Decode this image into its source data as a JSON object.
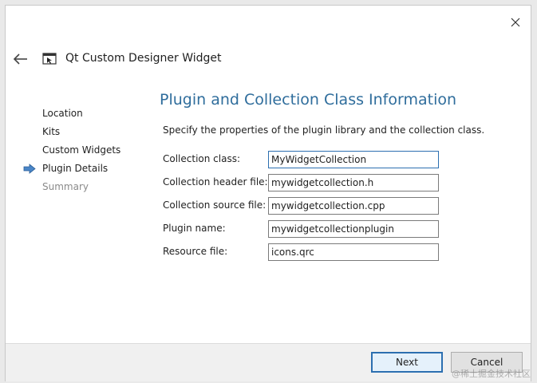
{
  "window": {
    "title": "Qt Custom Designer Widget",
    "app_icon": "qt-designer-widget-icon",
    "back_icon": "back-arrow-icon",
    "close_icon": "close-icon"
  },
  "steps": [
    {
      "label": "Location",
      "state": "done"
    },
    {
      "label": "Kits",
      "state": "done"
    },
    {
      "label": "Custom Widgets",
      "state": "done"
    },
    {
      "label": "Plugin Details",
      "state": "current"
    },
    {
      "label": "Summary",
      "state": "future"
    }
  ],
  "page": {
    "title": "Plugin and Collection Class Information",
    "description": "Specify the properties of the plugin library and the collection class."
  },
  "form": {
    "collection_class": {
      "label": "Collection class:",
      "value": "MyWidgetCollection"
    },
    "collection_header": {
      "label": "Collection header file:",
      "value": "mywidgetcollection.h"
    },
    "collection_source": {
      "label": "Collection source file:",
      "value": "mywidgetcollection.cpp"
    },
    "plugin_name": {
      "label": "Plugin name:",
      "value": "mywidgetcollectionplugin"
    },
    "resource_file": {
      "label": "Resource file:",
      "value": "icons.qrc"
    }
  },
  "footer": {
    "next_label": "Next",
    "cancel_label": "Cancel"
  },
  "watermark": "@稀土掘金技术社区",
  "colors": {
    "accent": "#2c6fb0",
    "title": "#2f6d9c",
    "disabled_text": "#8a8a8a",
    "footer_bg": "#f0f0f0"
  }
}
